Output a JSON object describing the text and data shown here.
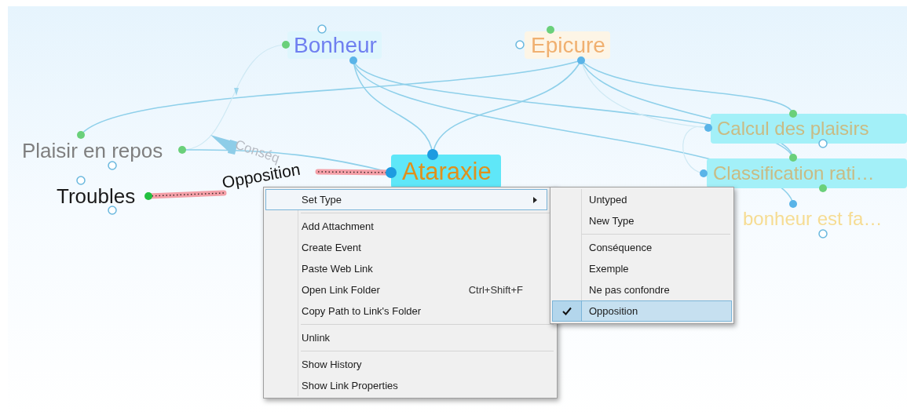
{
  "canvas": {
    "thoughts": [
      {
        "label": "Bonheur",
        "color": "#6f7ff0",
        "selected": false
      },
      {
        "label": "Epicure",
        "color": "#f0b070",
        "selected": false
      },
      {
        "label": "Plaisir en repos",
        "color": "#7f7f7f",
        "selected": false
      },
      {
        "label": "Troubles",
        "color": "#1a1a1a",
        "selected": false
      },
      {
        "label": "Ataraxie",
        "color": "#e0901c",
        "selected": true
      },
      {
        "label": "Calcul des plaisirs",
        "color": "#c9bb84",
        "selected": false
      },
      {
        "label": "Classification rati…",
        "color": "#c9bb84",
        "selected": false
      },
      {
        "label": "bonheur est fa…",
        "color": "#f6dc92",
        "selected": false
      }
    ],
    "links": [
      {
        "label": "Conséq",
        "selected": false
      },
      {
        "label": "Opposition",
        "selected": true
      }
    ]
  },
  "context_menu": {
    "groups": [
      [
        {
          "label": "Set Type",
          "submenu": true,
          "highlighted": true
        }
      ],
      [
        {
          "label": "Add Attachment",
          "submenu": false,
          "highlighted": false
        },
        {
          "label": "Create Event",
          "submenu": false,
          "highlighted": false
        },
        {
          "label": "Paste Web Link",
          "submenu": false,
          "highlighted": false
        },
        {
          "label": "Open Link Folder",
          "shortcut": "Ctrl+Shift+F",
          "submenu": false,
          "highlighted": false
        },
        {
          "label": "Copy Path to Link's Folder",
          "submenu": false,
          "highlighted": false
        }
      ],
      [
        {
          "label": "Unlink",
          "submenu": false,
          "highlighted": false
        }
      ],
      [
        {
          "label": "Show History",
          "submenu": false,
          "highlighted": false
        },
        {
          "label": "Show Link Properties",
          "submenu": false,
          "highlighted": false
        }
      ]
    ]
  },
  "type_submenu": {
    "groups": [
      [
        {
          "label": "Untyped",
          "selected": false
        },
        {
          "label": "New Type",
          "selected": false
        }
      ],
      [
        {
          "label": "Conséquence",
          "selected": false
        },
        {
          "label": "Exemple",
          "selected": false
        },
        {
          "label": "Ne pas confondre",
          "selected": false
        },
        {
          "label": "Opposition",
          "selected": true
        }
      ]
    ]
  }
}
